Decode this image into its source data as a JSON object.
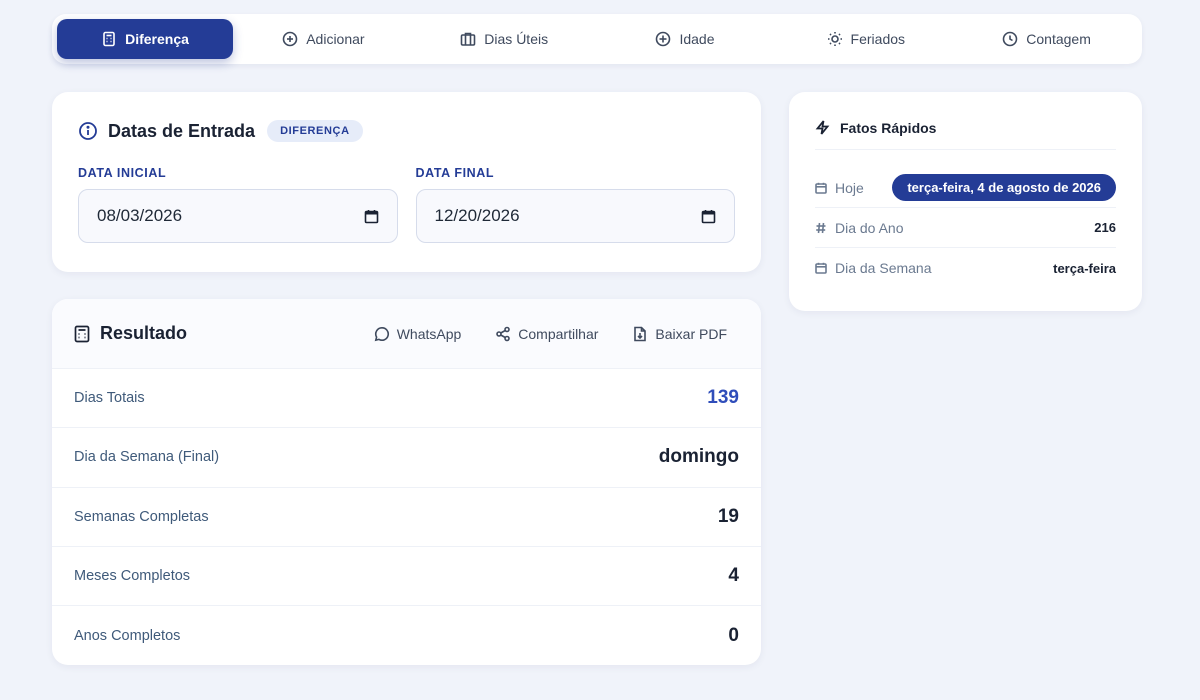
{
  "tabs": [
    {
      "label": "Diferença",
      "icon": "calculator-icon",
      "active": true
    },
    {
      "label": "Adicionar",
      "icon": "plus-circle-icon",
      "active": false
    },
    {
      "label": "Dias Úteis",
      "icon": "briefcase-icon",
      "active": false
    },
    {
      "label": "Idade",
      "icon": "clock-plus-icon",
      "active": false
    },
    {
      "label": "Feriados",
      "icon": "sun-icon",
      "active": false
    },
    {
      "label": "Contagem",
      "icon": "clock-icon",
      "active": false
    }
  ],
  "input": {
    "title": "Datas de Entrada",
    "badge": "DIFERENÇA",
    "start_label": "DATA INICIAL",
    "start_value": "08/03/2026",
    "end_label": "DATA FINAL",
    "end_value": "12/20/2026"
  },
  "result": {
    "title": "Resultado",
    "actions": {
      "whatsapp": "WhatsApp",
      "share": "Compartilhar",
      "pdf": "Baixar PDF"
    },
    "rows": [
      {
        "label": "Dias Totais",
        "value": "139"
      },
      {
        "label": "Dia da Semana (Final)",
        "value": "domingo"
      },
      {
        "label": "Semanas Completas",
        "value": "19"
      },
      {
        "label": "Meses Completos",
        "value": "4"
      },
      {
        "label": "Anos Completos",
        "value": "0"
      }
    ]
  },
  "facts": {
    "title": "Fatos Rápidos",
    "today_label": "Hoje",
    "today_value": "terça-feira, 4 de agosto de 2026",
    "day_of_year_label": "Dia do Ano",
    "day_of_year_value": "216",
    "weekday_label": "Dia da Semana",
    "weekday_value": "terça-feira"
  },
  "colors": {
    "accent": "#243c96",
    "background": "#f0f3fa",
    "value_accent": "#2f4dba"
  }
}
